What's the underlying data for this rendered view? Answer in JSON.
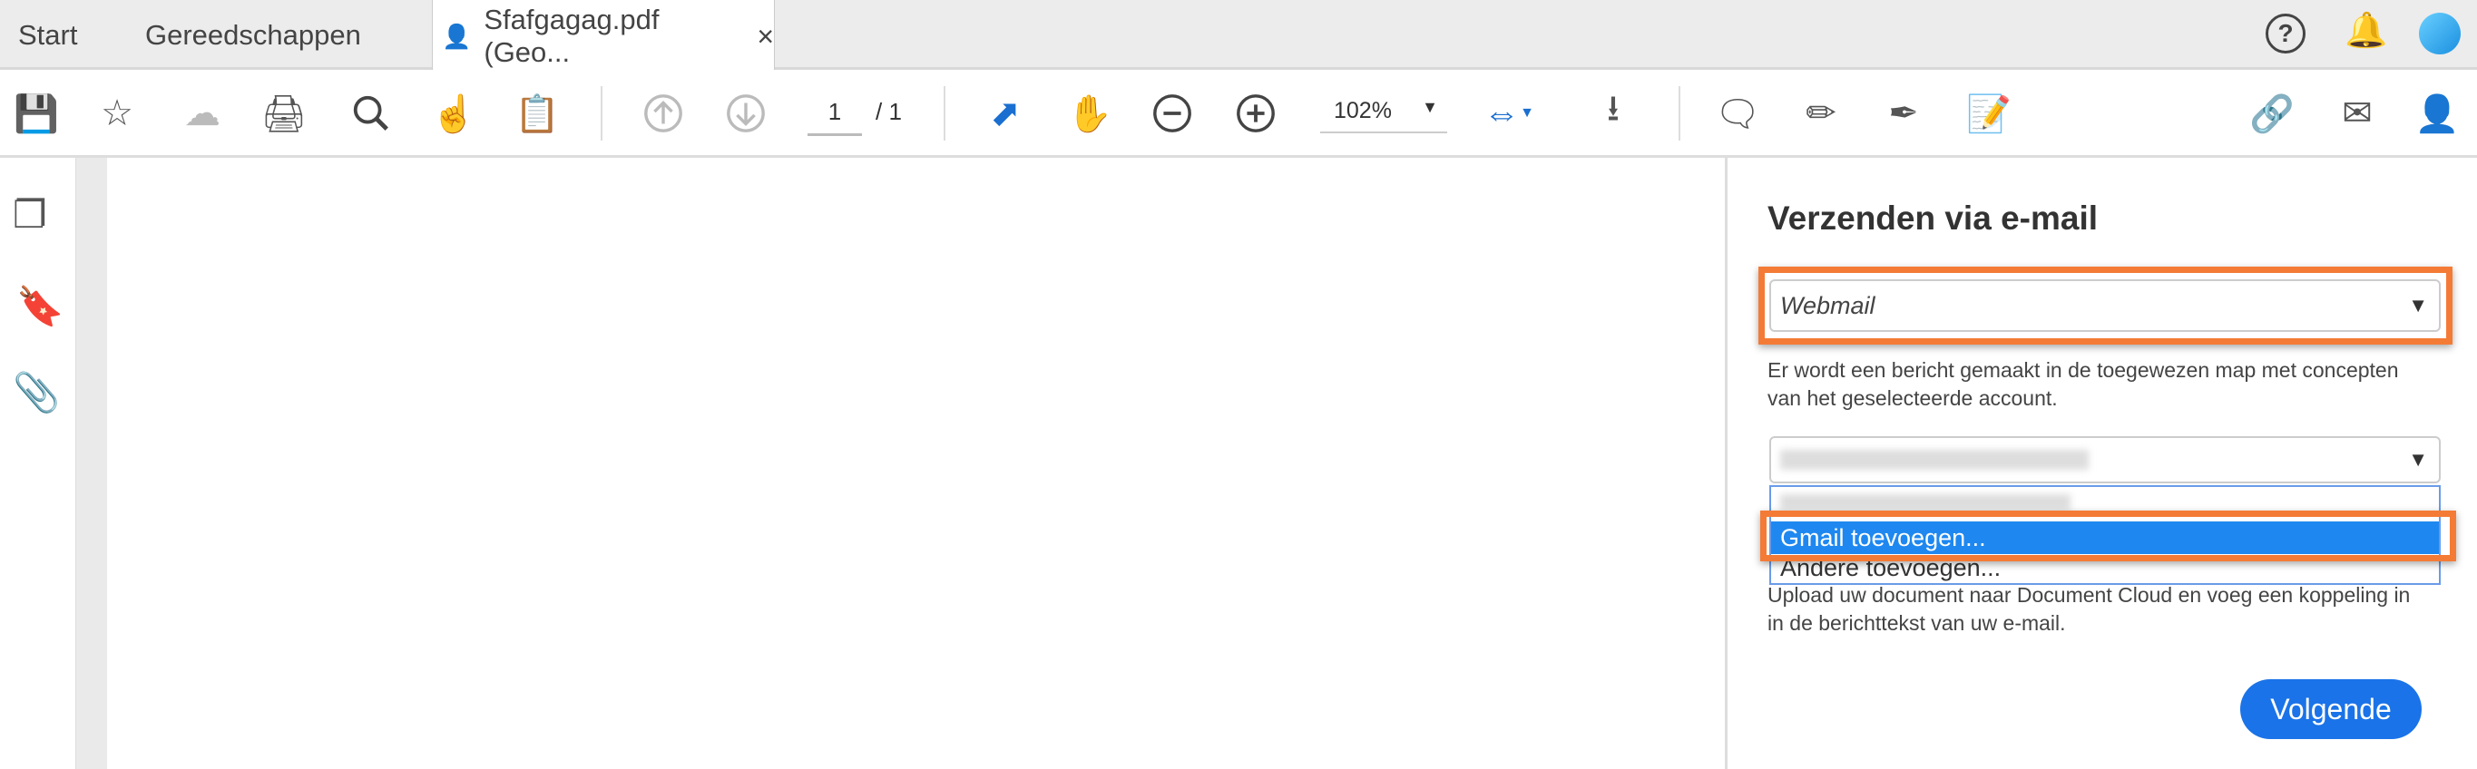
{
  "tabs": {
    "start": "Start",
    "tools": "Gereedschappen",
    "document": "Sfafgagag.pdf (Geo...",
    "close": "×"
  },
  "toolbar": {
    "page_current": "1",
    "page_total": "/ 1",
    "zoom": "102%"
  },
  "panel": {
    "title": "Verzenden via e-mail",
    "provider_select": "Webmail",
    "provider_description": "Er wordt een bericht gemaakt in de toegewezen map met concepten van het geselecteerde account.",
    "account_options": [
      "Gmail toevoegen...",
      "Andere toevoegen..."
    ],
    "upload_description": "Upload uw document naar Document Cloud en voeg een koppeling in in de berichttekst van uw e-mail.",
    "next_button": "Volgende"
  },
  "colors": {
    "accent": "#1a73e8",
    "highlight": "#f47b35",
    "selected": "#1e88f0"
  }
}
